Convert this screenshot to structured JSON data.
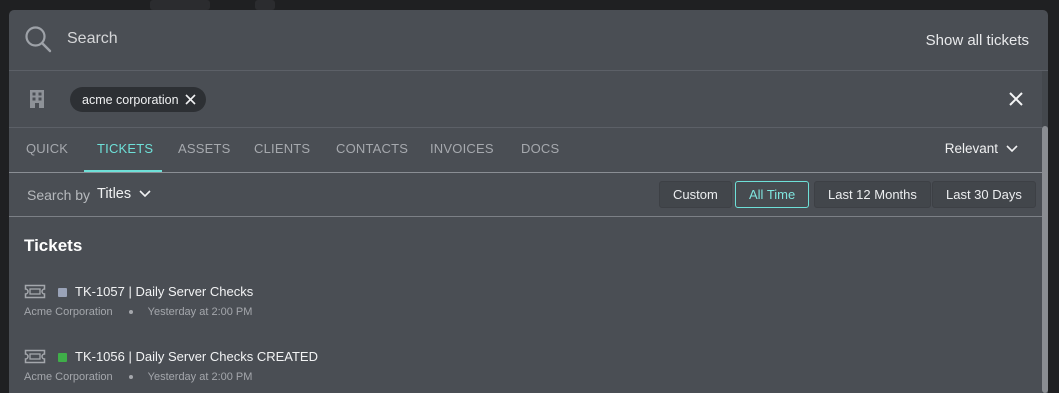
{
  "search": {
    "placeholder": "Search",
    "show_all_label": "Show all tickets"
  },
  "filter": {
    "chip_label": "acme corporation"
  },
  "tabs": [
    {
      "label": "QUICK",
      "active": false
    },
    {
      "label": "TICKETS",
      "active": true
    },
    {
      "label": "ASSETS",
      "active": false
    },
    {
      "label": "CLIENTS",
      "active": false
    },
    {
      "label": "CONTACTS",
      "active": false
    },
    {
      "label": "INVOICES",
      "active": false
    },
    {
      "label": "DOCS",
      "active": false
    }
  ],
  "sort": {
    "label": "Relevant"
  },
  "search_by": {
    "label": "Search by",
    "value": "Titles"
  },
  "ranges": [
    {
      "label": "Custom",
      "active": false
    },
    {
      "label": "All Time",
      "active": true
    },
    {
      "label": "Last 12 Months",
      "active": false
    },
    {
      "label": "Last 30 Days",
      "active": false
    }
  ],
  "results": {
    "section_title": "Tickets",
    "tickets": [
      {
        "title": "TK-1057 | Daily Server Checks",
        "client": "Acme Corporation",
        "time": "Yesterday at 2:00 PM",
        "status_color": "#9aa3b8"
      },
      {
        "title": "TK-1056 | Daily Server Checks CREATED",
        "client": "Acme Corporation",
        "time": "Yesterday at 2:00 PM",
        "status_color": "#3fae49"
      }
    ]
  },
  "colors": {
    "accent": "#6ee0d8",
    "panel_bg": "#4a4e54"
  }
}
